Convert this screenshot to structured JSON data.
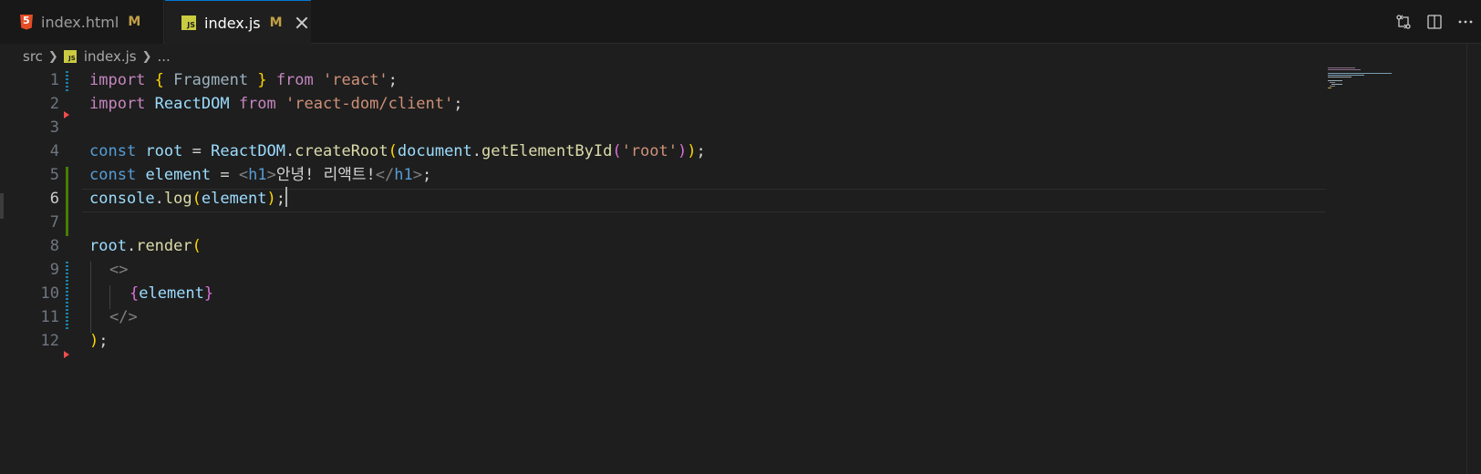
{
  "tabs": [
    {
      "name": "index.html",
      "status": "M",
      "icon": "html-file-icon"
    },
    {
      "name": "index.js",
      "status": "M",
      "icon": "js-file-icon",
      "active": true
    }
  ],
  "breadcrumb": {
    "folder": "src",
    "file": "index.js",
    "symbol": "..."
  },
  "icons": {
    "js_label": "JS"
  },
  "editor": {
    "active_line": 6,
    "line_numbers": [
      "1",
      "2",
      "3",
      "4",
      "5",
      "6",
      "7",
      "8",
      "9",
      "10",
      "11",
      "12"
    ],
    "code": {
      "l1": {
        "import": "import",
        "ob": "{",
        "frag": "Fragment",
        "cb": "}",
        "from": "from",
        "mod": "'react'",
        "semi": ";"
      },
      "l2": {
        "import": "import",
        "name": "ReactDOM",
        "from": "from",
        "mod": "'react-dom/client'",
        "semi": ";"
      },
      "l4": {
        "const": "const",
        "root": "root",
        "eq": "=",
        "rd": "ReactDOM",
        "dot": ".",
        "create": "createRoot",
        "op1": "(",
        "doc": "document",
        "dot2": ".",
        "get": "getElementById",
        "op2": "(",
        "str": "'root'",
        "cp2": ")",
        "cp1": ")",
        "semi": ";"
      },
      "l5": {
        "const": "const",
        "element": "element",
        "eq": "=",
        "open_lt": "<",
        "tag": "h1",
        "open_gt": ">",
        "text": "안녕! 리액트!",
        "close_lt": "</",
        "close_tag": "h1",
        "close_gt": ">",
        "semi": ";"
      },
      "l6": {
        "console": "console",
        "dot": ".",
        "log": "log",
        "op": "(",
        "arg": "element",
        "cp": ")",
        "semi": ";"
      },
      "l8": {
        "root": "root",
        "dot": ".",
        "render": "render",
        "op": "("
      },
      "l9": {
        "frag_open": "<>"
      },
      "l10": {
        "ob": "{",
        "expr": "element",
        "cb": "}"
      },
      "l11": {
        "frag_close": "</>"
      },
      "l12": {
        "cp": ")",
        "semi": ";"
      }
    }
  },
  "colors": {
    "accent": "#0078d4",
    "modified": "#c2a046",
    "added": "#487e02",
    "deleted": "#f14c4c"
  }
}
